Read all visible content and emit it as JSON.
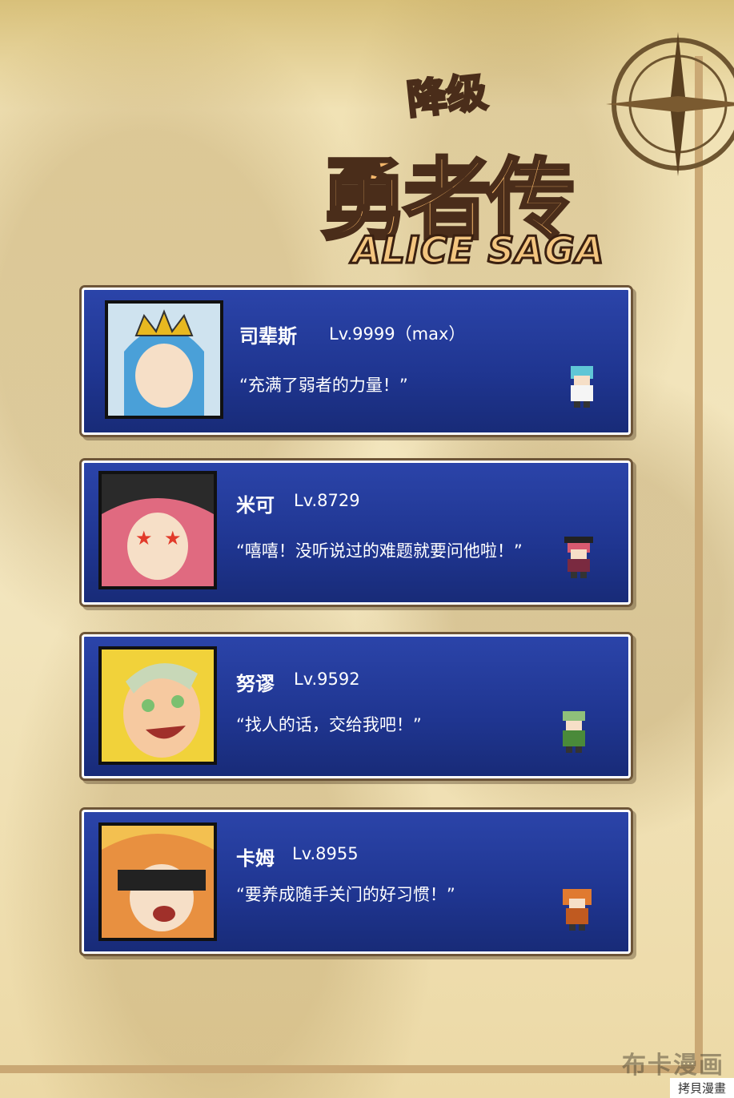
{
  "logo": {
    "subtitle": "降级",
    "title": "勇者传",
    "english": "ALICE SAGA"
  },
  "characters": [
    {
      "name": "司辈斯",
      "level": "Lv.9999（max）",
      "quote": "“充满了弱者的力量！”"
    },
    {
      "name": "米可",
      "level": "Lv.8729",
      "quote": "“嘻嘻！没听说过的难题就要问他啦！”"
    },
    {
      "name": "努谬",
      "level": "Lv.9592",
      "quote": "“找人的话，交给我吧！”"
    },
    {
      "name": "卡姆",
      "level": "Lv.8955",
      "quote": "“要养成随手关门的好习惯！”"
    }
  ],
  "watermark": {
    "text": "拷貝漫畫",
    "logo_text": "布卡漫画"
  },
  "colors": {
    "card_blue": "#1f3590",
    "map_parchment": "#f1e2b5"
  }
}
